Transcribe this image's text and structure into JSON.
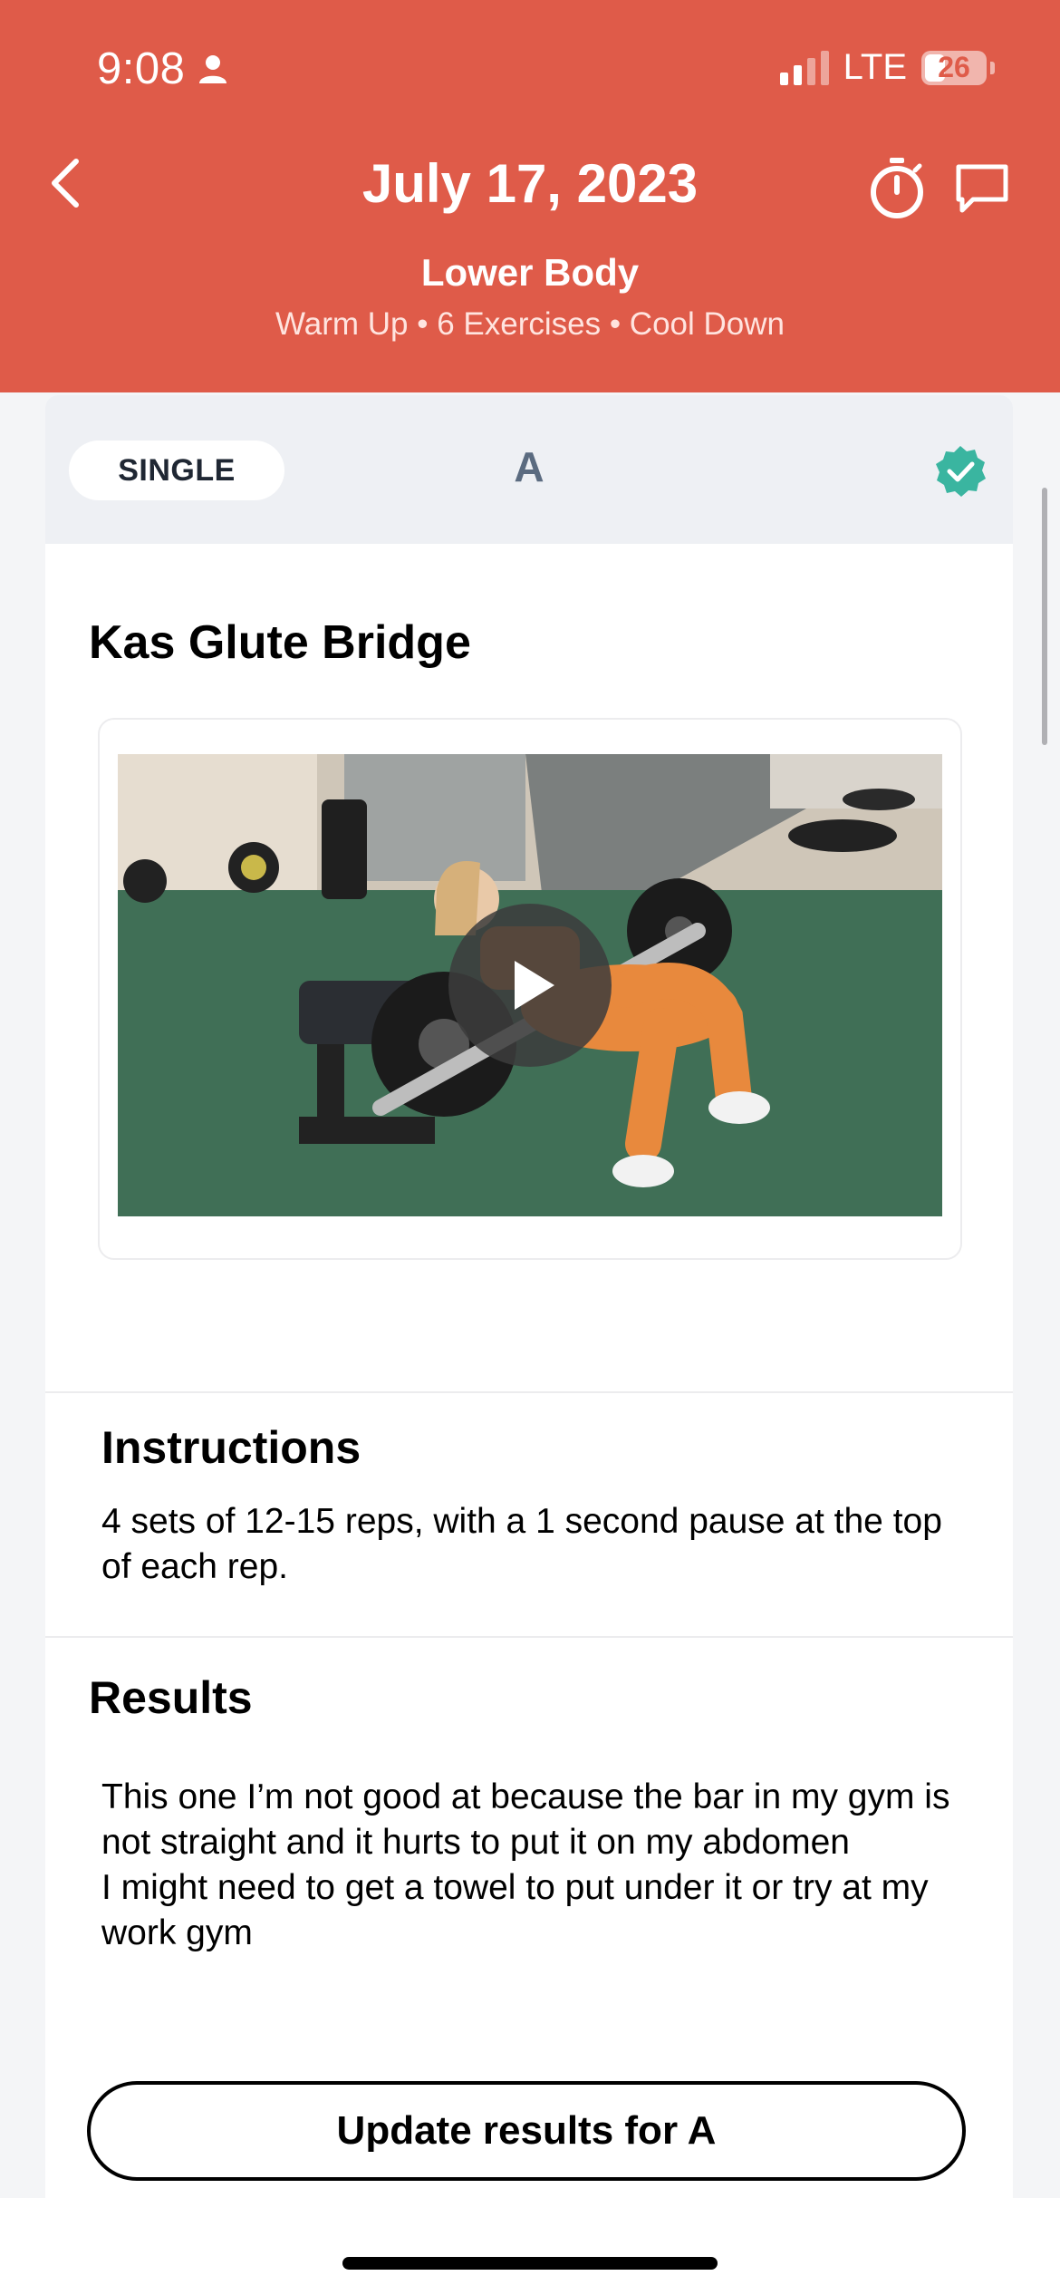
{
  "status_bar": {
    "time": "9:08",
    "network": "LTE",
    "battery": "26"
  },
  "header": {
    "title": "July 17, 2023",
    "subtitle": "Lower Body",
    "meta": "Warm Up • 6 Exercises • Cool Down"
  },
  "exercise_card": {
    "badge": "SINGLE",
    "letter": "A",
    "name": "Kas Glute Bridge",
    "completed": true,
    "accent_color": "#3ab5a0"
  },
  "instructions": {
    "heading": "Instructions",
    "text": "4 sets of 12-15 reps, with a 1 second pause at the top of each rep."
  },
  "results": {
    "heading": "Results",
    "text": "This one I’m not good at because the bar in my gym is not straight and it hurts to put it on my abdomen\nI might need to get a towel to put under it or try at my work gym"
  },
  "actions": {
    "update_label": "Update results for A"
  },
  "colors": {
    "header": "#df5b49",
    "badge_text": "#1f2733",
    "letter": "#5b6b80"
  }
}
